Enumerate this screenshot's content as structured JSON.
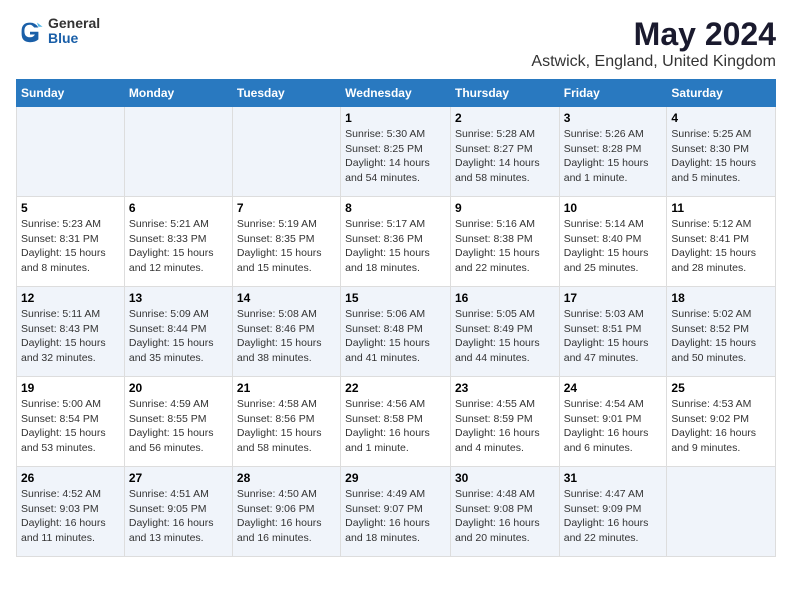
{
  "logo": {
    "general": "General",
    "blue": "Blue"
  },
  "title": "May 2024",
  "subtitle": "Astwick, England, United Kingdom",
  "headers": [
    "Sunday",
    "Monday",
    "Tuesday",
    "Wednesday",
    "Thursday",
    "Friday",
    "Saturday"
  ],
  "weeks": [
    [
      {
        "day": "",
        "info": ""
      },
      {
        "day": "",
        "info": ""
      },
      {
        "day": "",
        "info": ""
      },
      {
        "day": "1",
        "info": "Sunrise: 5:30 AM\nSunset: 8:25 PM\nDaylight: 14 hours\nand 54 minutes."
      },
      {
        "day": "2",
        "info": "Sunrise: 5:28 AM\nSunset: 8:27 PM\nDaylight: 14 hours\nand 58 minutes."
      },
      {
        "day": "3",
        "info": "Sunrise: 5:26 AM\nSunset: 8:28 PM\nDaylight: 15 hours\nand 1 minute."
      },
      {
        "day": "4",
        "info": "Sunrise: 5:25 AM\nSunset: 8:30 PM\nDaylight: 15 hours\nand 5 minutes."
      }
    ],
    [
      {
        "day": "5",
        "info": "Sunrise: 5:23 AM\nSunset: 8:31 PM\nDaylight: 15 hours\nand 8 minutes."
      },
      {
        "day": "6",
        "info": "Sunrise: 5:21 AM\nSunset: 8:33 PM\nDaylight: 15 hours\nand 12 minutes."
      },
      {
        "day": "7",
        "info": "Sunrise: 5:19 AM\nSunset: 8:35 PM\nDaylight: 15 hours\nand 15 minutes."
      },
      {
        "day": "8",
        "info": "Sunrise: 5:17 AM\nSunset: 8:36 PM\nDaylight: 15 hours\nand 18 minutes."
      },
      {
        "day": "9",
        "info": "Sunrise: 5:16 AM\nSunset: 8:38 PM\nDaylight: 15 hours\nand 22 minutes."
      },
      {
        "day": "10",
        "info": "Sunrise: 5:14 AM\nSunset: 8:40 PM\nDaylight: 15 hours\nand 25 minutes."
      },
      {
        "day": "11",
        "info": "Sunrise: 5:12 AM\nSunset: 8:41 PM\nDaylight: 15 hours\nand 28 minutes."
      }
    ],
    [
      {
        "day": "12",
        "info": "Sunrise: 5:11 AM\nSunset: 8:43 PM\nDaylight: 15 hours\nand 32 minutes."
      },
      {
        "day": "13",
        "info": "Sunrise: 5:09 AM\nSunset: 8:44 PM\nDaylight: 15 hours\nand 35 minutes."
      },
      {
        "day": "14",
        "info": "Sunrise: 5:08 AM\nSunset: 8:46 PM\nDaylight: 15 hours\nand 38 minutes."
      },
      {
        "day": "15",
        "info": "Sunrise: 5:06 AM\nSunset: 8:48 PM\nDaylight: 15 hours\nand 41 minutes."
      },
      {
        "day": "16",
        "info": "Sunrise: 5:05 AM\nSunset: 8:49 PM\nDaylight: 15 hours\nand 44 minutes."
      },
      {
        "day": "17",
        "info": "Sunrise: 5:03 AM\nSunset: 8:51 PM\nDaylight: 15 hours\nand 47 minutes."
      },
      {
        "day": "18",
        "info": "Sunrise: 5:02 AM\nSunset: 8:52 PM\nDaylight: 15 hours\nand 50 minutes."
      }
    ],
    [
      {
        "day": "19",
        "info": "Sunrise: 5:00 AM\nSunset: 8:54 PM\nDaylight: 15 hours\nand 53 minutes."
      },
      {
        "day": "20",
        "info": "Sunrise: 4:59 AM\nSunset: 8:55 PM\nDaylight: 15 hours\nand 56 minutes."
      },
      {
        "day": "21",
        "info": "Sunrise: 4:58 AM\nSunset: 8:56 PM\nDaylight: 15 hours\nand 58 minutes."
      },
      {
        "day": "22",
        "info": "Sunrise: 4:56 AM\nSunset: 8:58 PM\nDaylight: 16 hours\nand 1 minute."
      },
      {
        "day": "23",
        "info": "Sunrise: 4:55 AM\nSunset: 8:59 PM\nDaylight: 16 hours\nand 4 minutes."
      },
      {
        "day": "24",
        "info": "Sunrise: 4:54 AM\nSunset: 9:01 PM\nDaylight: 16 hours\nand 6 minutes."
      },
      {
        "day": "25",
        "info": "Sunrise: 4:53 AM\nSunset: 9:02 PM\nDaylight: 16 hours\nand 9 minutes."
      }
    ],
    [
      {
        "day": "26",
        "info": "Sunrise: 4:52 AM\nSunset: 9:03 PM\nDaylight: 16 hours\nand 11 minutes."
      },
      {
        "day": "27",
        "info": "Sunrise: 4:51 AM\nSunset: 9:05 PM\nDaylight: 16 hours\nand 13 minutes."
      },
      {
        "day": "28",
        "info": "Sunrise: 4:50 AM\nSunset: 9:06 PM\nDaylight: 16 hours\nand 16 minutes."
      },
      {
        "day": "29",
        "info": "Sunrise: 4:49 AM\nSunset: 9:07 PM\nDaylight: 16 hours\nand 18 minutes."
      },
      {
        "day": "30",
        "info": "Sunrise: 4:48 AM\nSunset: 9:08 PM\nDaylight: 16 hours\nand 20 minutes."
      },
      {
        "day": "31",
        "info": "Sunrise: 4:47 AM\nSunset: 9:09 PM\nDaylight: 16 hours\nand 22 minutes."
      },
      {
        "day": "",
        "info": ""
      }
    ]
  ]
}
